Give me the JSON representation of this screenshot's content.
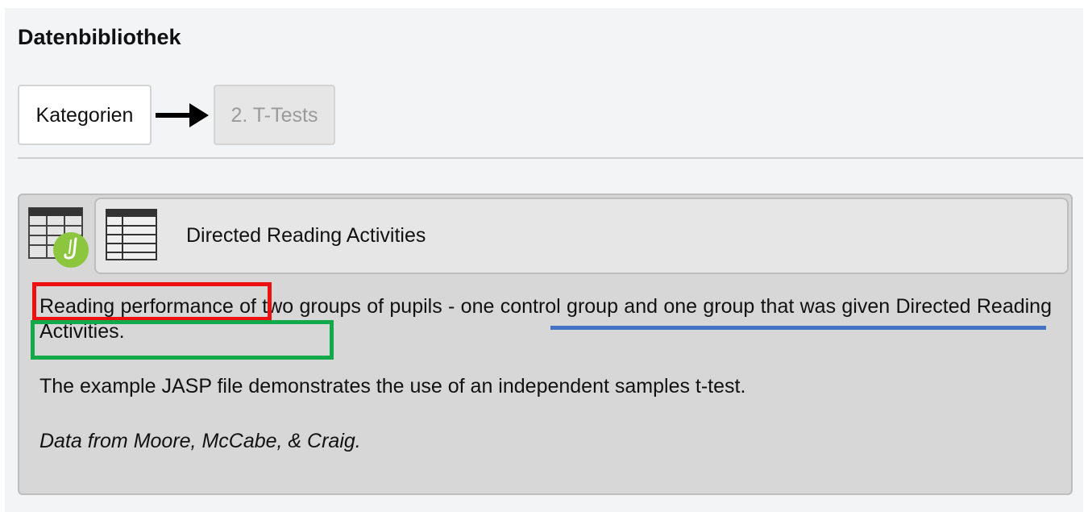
{
  "header": {
    "title": "Datenbibliothek"
  },
  "breadcrumb": {
    "root_label": "Kategorien",
    "current_label": "2. T-Tests"
  },
  "dataset": {
    "title": "Directed Reading Activities",
    "description": "Reading performance of two groups of pupils - one control group and one group that was given Directed Reading Activities.",
    "usage_note": "The example JASP file demonstrates the use of an independent samples t-test.",
    "source_note": "Data from Moore, McCabe, & Craig."
  },
  "icons": {
    "jasp_file": "jasp-table-icon",
    "dataset_table": "table-icon",
    "breadcrumb_arrow": "right-arrow-icon"
  },
  "colors": {
    "highlight_red": "#ee1111",
    "highlight_green": "#11a94a",
    "underline_blue": "#4472c4",
    "jasp_green": "#8cc63f"
  }
}
